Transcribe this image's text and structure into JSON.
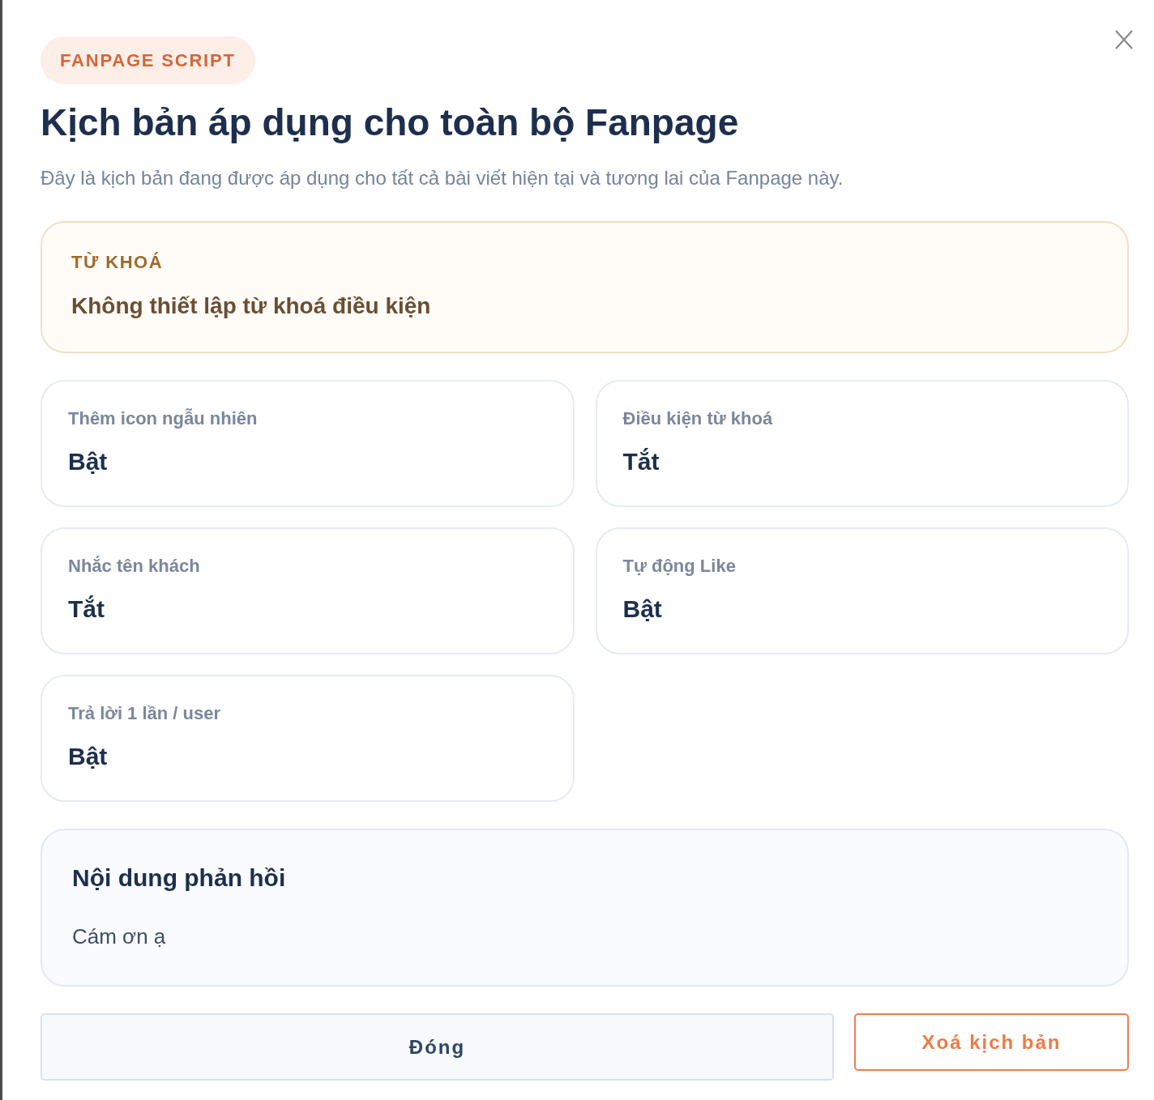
{
  "badge": "FANPAGE SCRIPT",
  "title": "Kịch bản áp dụng cho toàn bộ Fanpage",
  "subtitle": "Đây là kịch bản đang được áp dụng cho tất cả bài viết hiện tại và tương lai của Fanpage này.",
  "keyword": {
    "label": "TỪ KHOÁ",
    "value": "Không thiết lập từ khoá điều kiện"
  },
  "settings": [
    {
      "label": "Thêm icon ngẫu nhiên",
      "value": "Bật"
    },
    {
      "label": "Điều kiện từ khoá",
      "value": "Tắt"
    },
    {
      "label": "Nhắc tên khách",
      "value": "Tắt"
    },
    {
      "label": "Tự động Like",
      "value": "Bật"
    },
    {
      "label": "Trả lời 1 lần / user",
      "value": "Bật"
    }
  ],
  "response": {
    "title": "Nội dung phản hồi",
    "text": "Cám ơn ạ"
  },
  "buttons": [
    {
      "label": "Đóng",
      "kind": "secondary"
    },
    {
      "label": "Xoá kịch bản",
      "kind": "danger"
    }
  ]
}
